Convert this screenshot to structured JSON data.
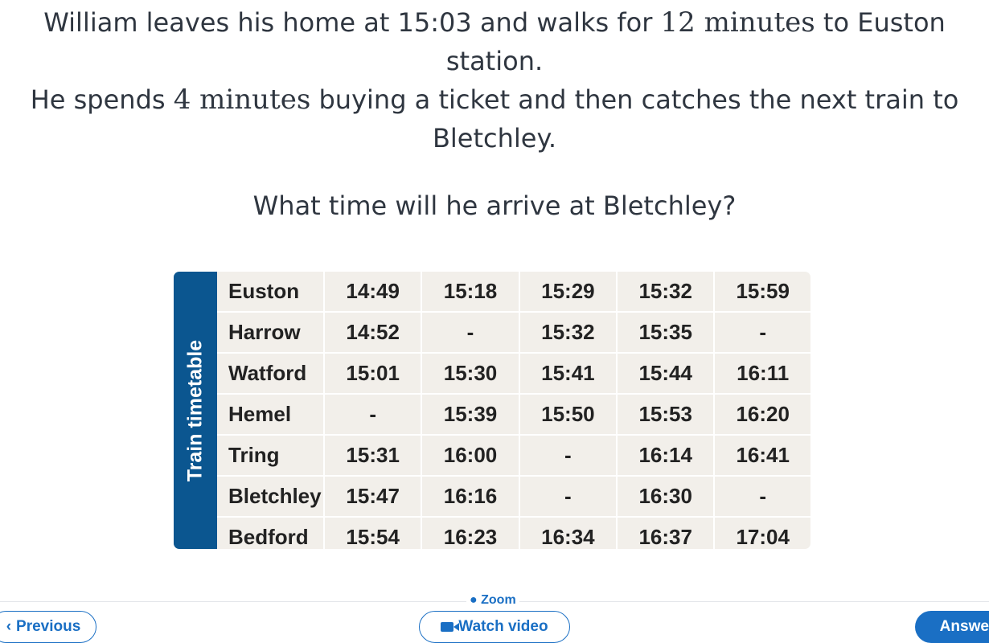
{
  "question": {
    "line1_a": "William leaves his home at 15:03 and walks for ",
    "line1_math": "12 minutes",
    "line1_b": " to Euston station.",
    "line2_a": "He spends ",
    "line2_math": "4 minutes",
    "line2_b": " buying a ticket and then catches the next train to Bletchley."
  },
  "prompt": "What time will he arrive at Bletchley?",
  "timetable": {
    "title": "Train timetable",
    "rows": [
      {
        "station": "Euston",
        "times": [
          "14:49",
          "15:18",
          "15:29",
          "15:32",
          "15:59"
        ]
      },
      {
        "station": "Harrow",
        "times": [
          "14:52",
          "-",
          "15:32",
          "15:35",
          "-"
        ]
      },
      {
        "station": "Watford",
        "times": [
          "15:01",
          "15:30",
          "15:41",
          "15:44",
          "16:11"
        ]
      },
      {
        "station": "Hemel",
        "times": [
          "-",
          "15:39",
          "15:50",
          "15:53",
          "16:20"
        ]
      },
      {
        "station": "Tring",
        "times": [
          "15:31",
          "16:00",
          "-",
          "16:14",
          "16:41"
        ]
      },
      {
        "station": "Bletchley",
        "times": [
          "15:47",
          "16:16",
          "-",
          "16:30",
          "-"
        ]
      },
      {
        "station": "Bedford",
        "times": [
          "15:54",
          "16:23",
          "16:34",
          "16:37",
          "17:04"
        ]
      }
    ]
  },
  "footer": {
    "zoom_label": "Zoom",
    "previous_label": "Previous",
    "video_label": "Watch video",
    "answer_label": "Answer"
  }
}
